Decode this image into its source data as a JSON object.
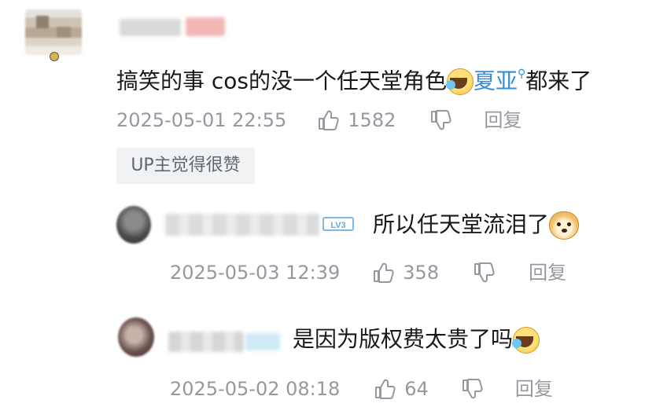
{
  "main_comment": {
    "text_before": "搞笑的事 cos的没一个任天堂角色",
    "mention": "夏亚",
    "text_after": "都来了",
    "emoji": "laugh-cry-emoji",
    "timestamp": "2025-05-01 22:55",
    "like_count": "1582",
    "reply_label": "回复",
    "up_liked": "UP主觉得很赞"
  },
  "replies": [
    {
      "level_badge": "LV3",
      "text": "所以任天堂流泪了",
      "emoji": "doge-emoji",
      "timestamp": "2025-05-03 12:39",
      "like_count": "358",
      "reply_label": "回复"
    },
    {
      "text": "是因为版权费太贵了吗",
      "emoji": "laugh-cry-emoji",
      "timestamp": "2025-05-02 08:18",
      "like_count": "64",
      "reply_label": "回复"
    }
  ],
  "colors": {
    "meta_gray": "#9499a0",
    "mention_blue": "#3a8ed3",
    "text": "#18191c",
    "up_liked_bg": "#f1f2f3"
  }
}
